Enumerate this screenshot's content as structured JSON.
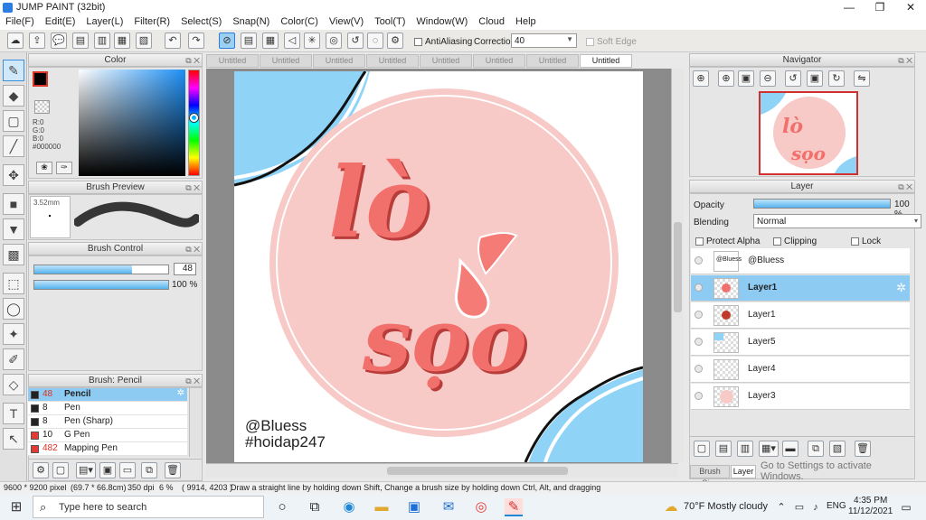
{
  "window": {
    "title": "JUMP PAINT (32bit)",
    "min": "—",
    "restore": "❐",
    "close": "✕"
  },
  "menu": [
    "File(F)",
    "Edit(E)",
    "Layer(L)",
    "Filter(R)",
    "Select(S)",
    "Snap(N)",
    "Color(C)",
    "View(V)",
    "Tool(T)",
    "Window(W)",
    "Cloud",
    "Help"
  ],
  "toolbar": {
    "antialiasing_label": "AntiAliasing",
    "correction_label": "Correction",
    "correction_value": "40",
    "soft_edge_label": "Soft Edge"
  },
  "color_panel": {
    "title": "Color",
    "r": "R:0",
    "g": "G:0",
    "b": "B:0",
    "hex": "#000000"
  },
  "brush_preview": {
    "title": "Brush Preview",
    "size": "3.52mm"
  },
  "brush_control": {
    "title": "Brush Control",
    "size_value": "48",
    "opacity_value": "100 %",
    "size_fill": 0.73,
    "opacity_fill": 1.0
  },
  "brush_list": {
    "title": "Brush: Pencil",
    "items": [
      {
        "size": "48",
        "name": "Pencil",
        "color": "#222222"
      },
      {
        "size": "8",
        "name": "Pen",
        "color": "#222222"
      },
      {
        "size": "8",
        "name": "Pen (Sharp)",
        "color": "#222222"
      },
      {
        "size": "10",
        "name": "G Pen",
        "color": "#e53935"
      },
      {
        "size": "482",
        "name": "Mapping Pen",
        "color": "#e53935"
      }
    ]
  },
  "tabs": [
    "Untitled",
    "Untitled",
    "Untitled",
    "Untitled",
    "Untitled",
    "Untitled",
    "Untitled",
    "Untitled"
  ],
  "artwork": {
    "line1": "lò",
    "line2": "sọo",
    "credit1": "@Bluess",
    "credit2": "#hoidap247",
    "circle_color": "#f7c9c7",
    "accent": "#7fcdf3"
  },
  "navigator": {
    "title": "Navigator"
  },
  "layer_panel": {
    "title": "Layer",
    "opacity_label": "Opacity",
    "opacity_value": "100 %",
    "blending_label": "Blending",
    "blending_value": "Normal",
    "protect_alpha": "Protect Alpha",
    "clipping": "Clipping",
    "lock": "Lock",
    "layers": [
      {
        "name": "@Bluess"
      },
      {
        "name": "Layer1"
      },
      {
        "name": "Layer1"
      },
      {
        "name": "Layer5"
      },
      {
        "name": "Layer4"
      },
      {
        "name": "Layer3"
      }
    ],
    "tabs": [
      "Brush Size",
      "Layer"
    ]
  },
  "watermark": "Go to Settings to activate Windows.",
  "status": {
    "size": "9600 * 9200 pixel",
    "cm": "(69.7 * 66.8cm)",
    "dpi": "350 dpi",
    "zoom": "6 %",
    "coords": "( 9914, 4203 )",
    "hint": "Draw a straight line by holding down Shift, Change a brush size by holding down Ctrl, Alt, and dragging"
  },
  "taskbar": {
    "search_placeholder": "Type here to search",
    "weather": "70°F  Mostly cloudy",
    "lang": "ENG",
    "time": "4:35 PM",
    "date": "11/12/2021"
  }
}
